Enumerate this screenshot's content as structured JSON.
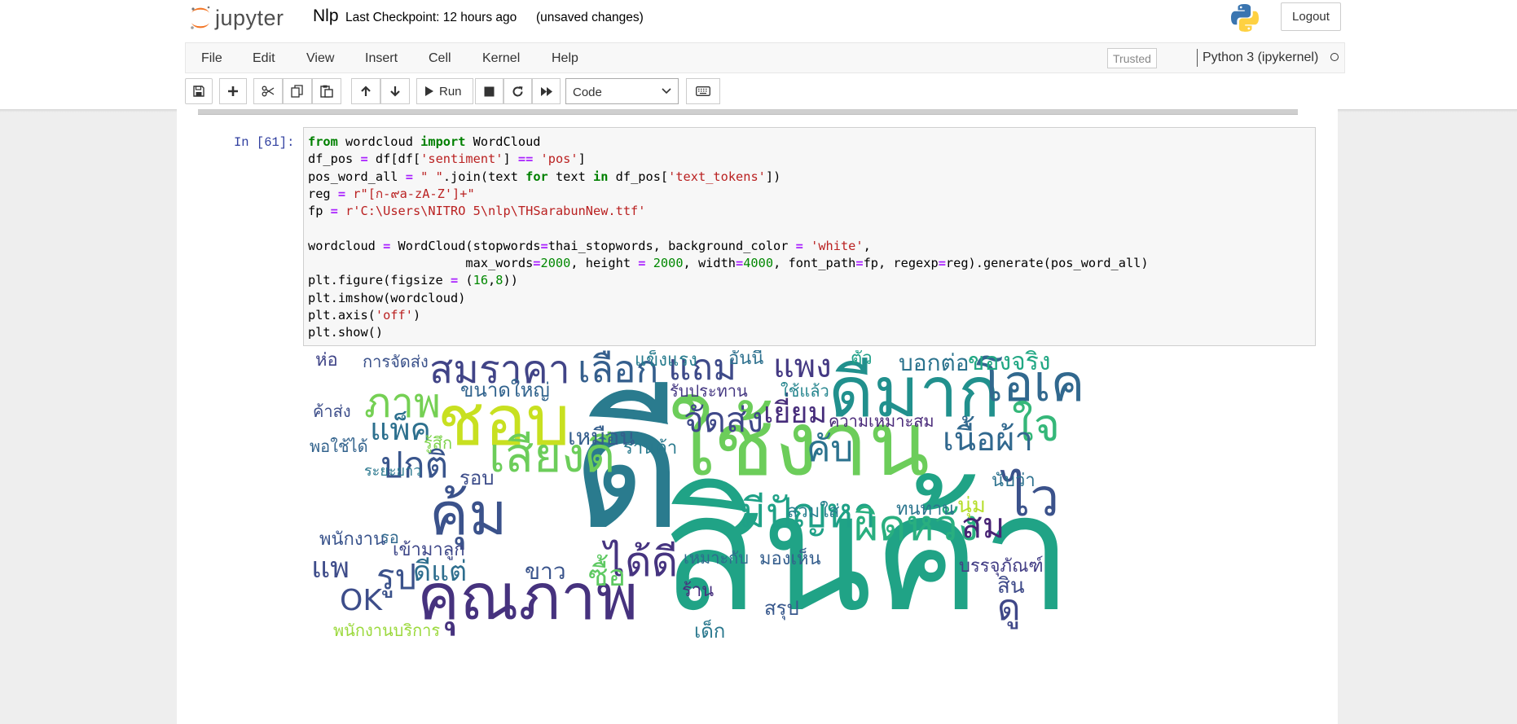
{
  "header": {
    "logo_text": "jupyter",
    "notebook_name": "Nlp",
    "checkpoint_text": "Last Checkpoint: 12 hours ago",
    "unsaved_text": "(unsaved changes)",
    "logout_label": "Logout"
  },
  "menubar": {
    "items": [
      "File",
      "Edit",
      "View",
      "Insert",
      "Cell",
      "Kernel",
      "Help"
    ],
    "trusted_label": "Trusted",
    "kernel_name": "Python 3 (ipykernel)"
  },
  "toolbar": {
    "run_label": "Run",
    "cell_type": "Code",
    "icons": [
      "save-icon",
      "plus-icon",
      "cut-icon",
      "copy-icon",
      "paste-icon",
      "arrow-up-icon",
      "arrow-down-icon",
      "play-icon",
      "stop-icon",
      "restart-icon",
      "fast-forward-icon",
      "keyboard-icon"
    ]
  },
  "cell": {
    "prompt": "In [61]:",
    "code_lines": [
      "from wordcloud import WordCloud",
      "df_pos = df[df['sentiment'] == 'pos']",
      "pos_word_all = \" \".join(text for text in df_pos['text_tokens'])",
      "reg = r\"[ก-๙a-zA-Z']+\"",
      "fp = r'C:\\Users\\NITRO 5\\nlp\\THSarabunNew.ttf'",
      "",
      "wordcloud = WordCloud(stopwords=thai_stopwords, background_color = 'white',",
      "                     max_words=2000, height = 2000, width=4000, font_path=fp, regexp=reg).generate(pos_word_all)",
      "plt.figure(figsize = (16,8))",
      "plt.imshow(wordcloud)",
      "plt.axis('off')",
      "plt.show()"
    ]
  },
  "wordcloud": {
    "words": [
      {
        "text": "ดี",
        "color": "#2a7b8e"
      },
      {
        "text": "สินค้า",
        "color": "#20a386"
      },
      {
        "text": "ใช้งาน",
        "color": "#6ccd5a"
      },
      {
        "text": "ดีมาก",
        "color": "#21908d"
      },
      {
        "text": "ชอบ",
        "color": "#c8e020"
      },
      {
        "text": "คุ้ม",
        "color": "#3b528b"
      },
      {
        "text": "คุณภาพ",
        "color": "#46327e"
      },
      {
        "text": "สมราคา",
        "color": "#414487"
      },
      {
        "text": "เลือก",
        "color": "#355f8d"
      },
      {
        "text": "แถม",
        "color": "#3e4a89"
      },
      {
        "text": "แพง",
        "color": "#443983"
      },
      {
        "text": "โอเค",
        "color": "#31688e"
      },
      {
        "text": "ภาพ",
        "color": "#75d054"
      },
      {
        "text": "แพ็ค",
        "color": "#2d708e"
      },
      {
        "text": "จัดส่ง",
        "color": "#3f4889"
      },
      {
        "text": "เยี่ยม",
        "color": "#472d7b"
      },
      {
        "text": "คับ",
        "color": "#2c728e"
      },
      {
        "text": "ไว",
        "color": "#3b528b"
      },
      {
        "text": "ใจ",
        "color": "#35b779"
      },
      {
        "text": "เนื้อผ้า",
        "color": "#31688e"
      },
      {
        "text": "มีปัญหา",
        "color": "#1fa187"
      },
      {
        "text": "ผิดหวัง",
        "color": "#29af7f"
      },
      {
        "text": "สม",
        "color": "#482475"
      },
      {
        "text": "ได้ดี",
        "color": "#463480"
      },
      {
        "text": "เสียงดี",
        "color": "#6ccd5a"
      },
      {
        "text": "ปกติ",
        "color": "#39558c"
      },
      {
        "text": "OK",
        "color": "#3d4d8a"
      },
      {
        "text": "รูป",
        "color": "#3b528b"
      },
      {
        "text": "ดีแต่",
        "color": "#2e6e8e"
      },
      {
        "text": "ซื้อ",
        "color": "#5ec962"
      },
      {
        "text": "ขาว",
        "color": "#3a548c"
      },
      {
        "text": "แพ",
        "color": "#3e4c8a"
      },
      {
        "text": "เหมือน",
        "color": "#355e8d"
      },
      {
        "text": "ของจริง",
        "color": "#22a884"
      },
      {
        "text": "บอกต่อ",
        "color": "#2c738e"
      },
      {
        "text": "ห่อ",
        "color": "#404588"
      },
      {
        "text": "การจัดส่ง",
        "color": "#3b528b"
      },
      {
        "text": "ขนาดใหญ่",
        "color": "#32648e"
      },
      {
        "text": "ร้านค้า",
        "color": "#297a8e"
      },
      {
        "text": "ความเหมาะสม",
        "color": "#482878"
      },
      {
        "text": "แข็งแรง",
        "color": "#287c8e"
      },
      {
        "text": "อันนี้",
        "color": "#2d708e"
      },
      {
        "text": "ตัว",
        "color": "#1fa088"
      },
      {
        "text": "รับประทาน",
        "color": "#453882"
      },
      {
        "text": "ใช้แล้ว",
        "color": "#25858e"
      },
      {
        "text": "ค้าส่ง",
        "color": "#3d4e8a"
      },
      {
        "text": "พอใช้ได้",
        "color": "#33638d"
      },
      {
        "text": "ระยะยาว",
        "color": "#2a778e"
      },
      {
        "text": "พนักงาน",
        "color": "#3a548c"
      },
      {
        "text": "รอ",
        "color": "#31688e"
      },
      {
        "text": "เข้ามาลูก",
        "color": "#3f4889"
      },
      {
        "text": "ทนทาน",
        "color": "#2b758e"
      },
      {
        "text": "นุ่ม",
        "color": "#b5de2b"
      },
      {
        "text": "บรรจุภัณฑ์",
        "color": "#433e85"
      },
      {
        "text": "สวมใส่",
        "color": "#27808e"
      },
      {
        "text": "เหมาะกับ",
        "color": "#2f6c8e"
      },
      {
        "text": "มองเห็น",
        "color": "#355e8d"
      },
      {
        "text": "นับว่า",
        "color": "#2c718e"
      },
      {
        "text": "สรุป",
        "color": "#38588c"
      },
      {
        "text": "รู้สึก",
        "color": "#7fd34e"
      },
      {
        "text": "รอบ",
        "color": "#3d4d8a"
      },
      {
        "text": "พนักงานบริการ",
        "color": "#9bd93c"
      },
      {
        "text": "เด็ก",
        "color": "#2a788e"
      },
      {
        "text": "สิน",
        "color": "#3e4a89"
      },
      {
        "text": "ดู",
        "color": "#3f4788"
      },
      {
        "text": "ร้าน",
        "color": "#46307e"
      }
    ]
  }
}
